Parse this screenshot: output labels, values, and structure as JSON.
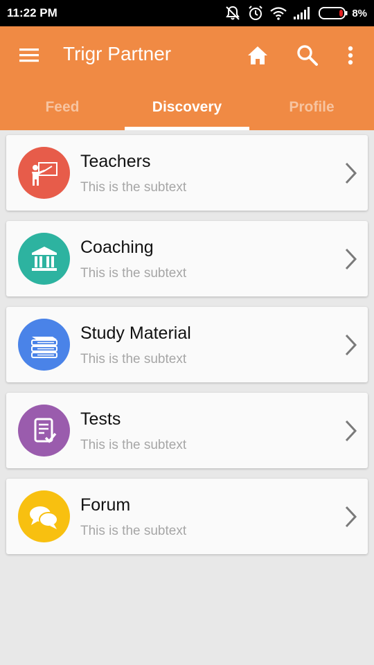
{
  "status_bar": {
    "time": "11:22 PM",
    "battery": "8%",
    "icons": [
      "mute-icon",
      "alarm-icon",
      "wifi-icon",
      "signal-icon",
      "battery-icon"
    ]
  },
  "app_bar": {
    "title": "Trigr Partner",
    "color": "#f08a44",
    "actions": [
      "home-icon",
      "search-icon",
      "more-vert-icon"
    ]
  },
  "tabs": [
    {
      "label": "Feed",
      "active": false
    },
    {
      "label": "Discovery",
      "active": true
    },
    {
      "label": "Profile",
      "active": false
    }
  ],
  "items": [
    {
      "title": "Teachers",
      "subtitle": "This is the subtext",
      "icon": "teacher-board-icon",
      "color": "#e75c4a"
    },
    {
      "title": "Coaching",
      "subtitle": "This is the subtext",
      "icon": "institution-icon",
      "color": "#2db3a0"
    },
    {
      "title": "Study Material",
      "subtitle": "This is the subtext",
      "icon": "books-icon",
      "color": "#4a83e8"
    },
    {
      "title": "Tests",
      "subtitle": "This is the subtext",
      "icon": "test-sheet-icon",
      "color": "#9a5cad"
    },
    {
      "title": "Forum",
      "subtitle": "This is the subtext",
      "icon": "chat-bubbles-icon",
      "color": "#f8c010"
    }
  ]
}
